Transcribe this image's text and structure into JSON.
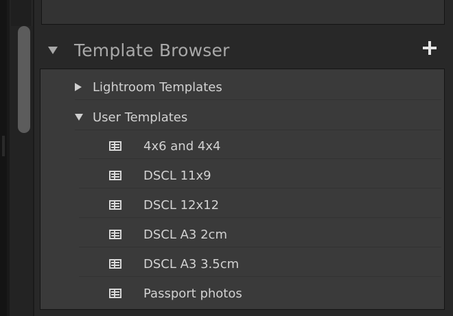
{
  "panel": {
    "header": {
      "title": "Template Browser"
    },
    "folders": [
      {
        "label": "Lightroom Templates",
        "expanded": false
      },
      {
        "label": "User Templates",
        "expanded": true
      }
    ],
    "user_templates": [
      {
        "label": "4x6 and 4x4"
      },
      {
        "label": "DSCL 11x9"
      },
      {
        "label": "DSCL 12x12"
      },
      {
        "label": "DSCL A3 2cm"
      },
      {
        "label": "DSCL A3 3.5cm"
      },
      {
        "label": "Passport photos"
      }
    ]
  },
  "icons": {
    "header_toggle": "triangle-down-icon",
    "add": "plus-icon",
    "collapsed_folder": "triangle-right-icon",
    "expanded_folder": "triangle-down-icon",
    "template": "template-grid-icon"
  },
  "colors": {
    "panel_bg": "#282828",
    "list_bg": "#3a3a3a",
    "header_text": "#a8a8a8",
    "item_text": "#d2d2d2",
    "scroll_thumb": "#5c5c5c"
  }
}
